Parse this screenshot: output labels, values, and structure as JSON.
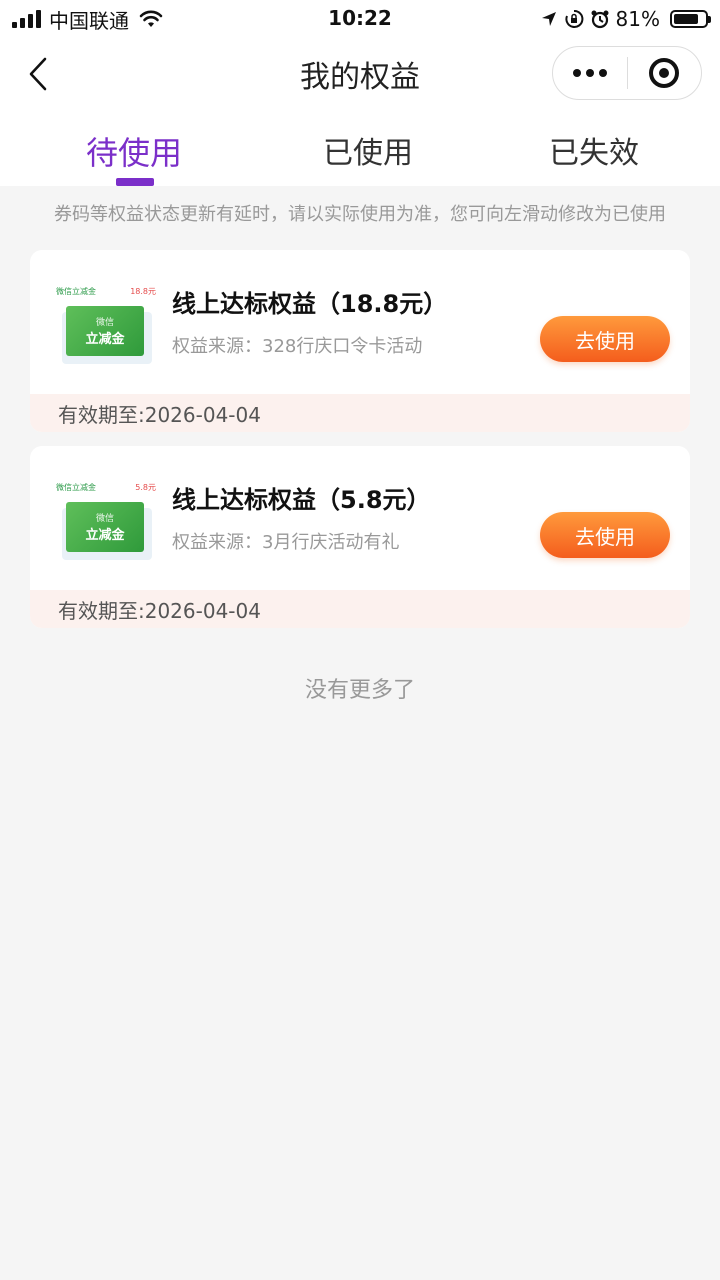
{
  "status_bar": {
    "carrier": "中国联通",
    "time": "10:22",
    "battery_percent": "81%",
    "battery_level": 0.81,
    "icons": [
      "signal-icon",
      "wifi-icon",
      "location-arrow-icon",
      "rotation-lock-icon",
      "alarm-icon",
      "battery-icon"
    ]
  },
  "nav": {
    "title": "我的权益",
    "icons": [
      "back-chevron-icon",
      "more-dots-icon",
      "close-target-icon"
    ]
  },
  "tabs": [
    {
      "label": "待使用",
      "active": true
    },
    {
      "label": "已使用",
      "active": false
    },
    {
      "label": "已失效",
      "active": false
    }
  ],
  "notice": "券码等权益状态更新有延时，请以实际使用为准，您可向左滑动修改为已使用",
  "coupons": [
    {
      "thumb_label": "微信立减金",
      "thumb_amount": "18.8元",
      "thumb_sub": "微信",
      "thumb_main": "立减金",
      "title": "线上达标权益（18.8元）",
      "source": "权益来源：328行庆口令卡活动",
      "button": "去使用",
      "expiry": "有效期至:2026-04-04"
    },
    {
      "thumb_label": "微信立减金",
      "thumb_amount": "5.8元",
      "thumb_sub": "微信",
      "thumb_main": "立减金",
      "title": "线上达标权益（5.8元）",
      "source": "权益来源：3月行庆活动有礼",
      "button": "去使用",
      "expiry": "有效期至:2026-04-04"
    }
  ],
  "no_more": "没有更多了",
  "colors": {
    "accent": "#7b2fc9",
    "button_start": "#ff9a3c",
    "button_end": "#f45d1d",
    "card_green": "#2f9a3b",
    "footer_bg": "#fcf1ee"
  }
}
